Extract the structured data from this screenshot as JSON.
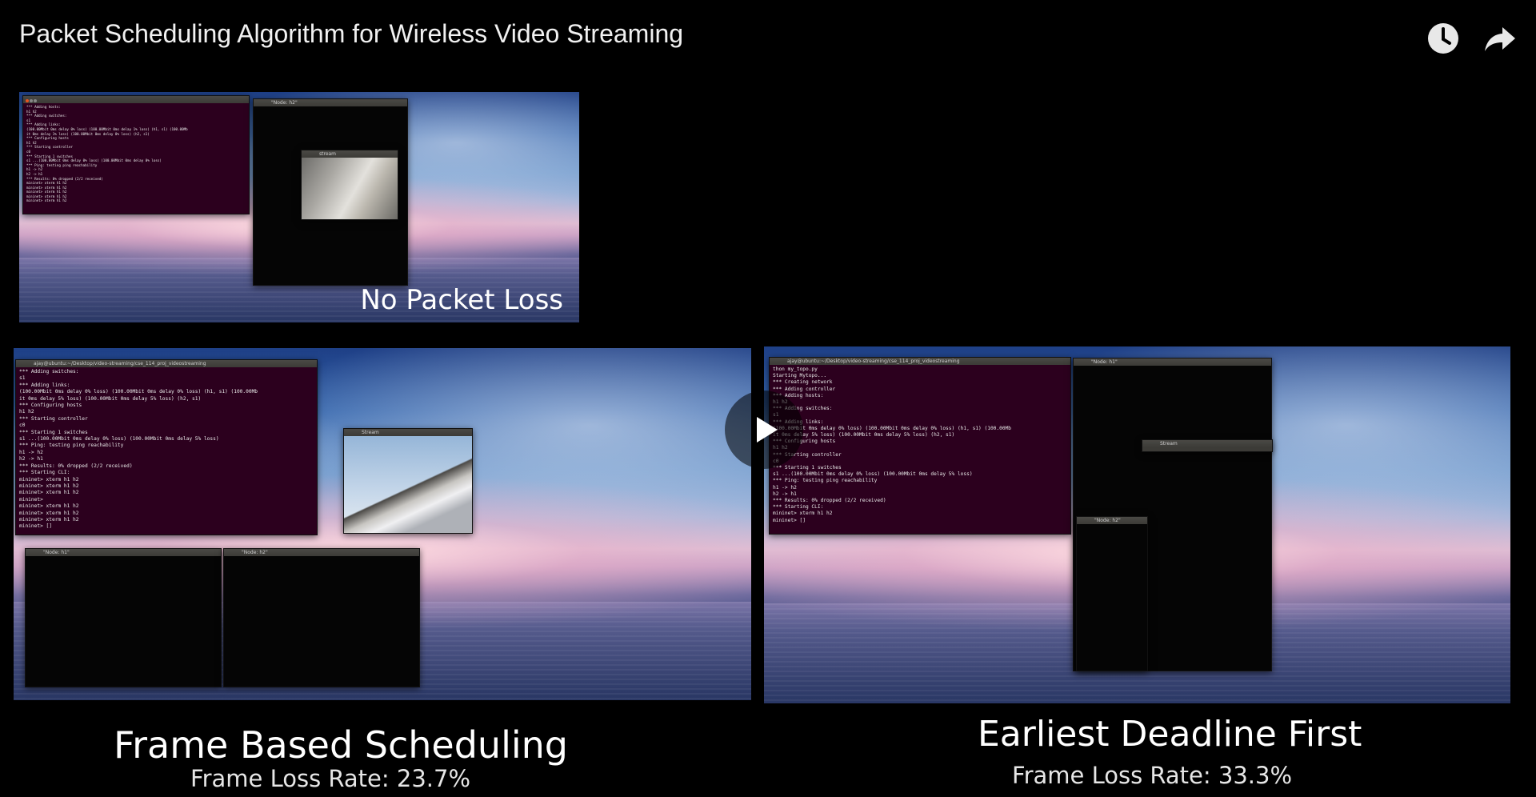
{
  "video": {
    "title": "Packet Scheduling Algorithm for Wireless Video Streaming",
    "actions": [
      "clock-icon",
      "share-icon"
    ]
  },
  "panels": {
    "no_loss": {
      "label": "No Packet Loss",
      "terminal_lines": "*** Adding hosts:\nh1 h2\n*** Adding switches:\ns1\n*** Adding links:\n(100.00Mbit 0ms delay 0% loss) (100.00Mbit 0ms delay 1% loss) (h1, s1) (100.00Mb\nit 0ms delay 1% loss) (100.00Mbit 0ms delay 0% loss) (h2, s1)\n*** Configuring hosts\nh1 h2\n*** Starting controller\nc0\n*** Starting 1 switches\ns1 ...(100.00Mbit 0ms delay 0% loss) (100.00Mbit 0ms delay 0% loss)\n*** Ping: testing ping reachability\nh1 -> h2\nh2 -> h1\n*** Results: 0% dropped (2/2 received)\nmininet> xterm h1 h2\nmininet> xterm h1 h2\nmininet> xterm h1 h2\nmininet> xterm h1 h2\nmininet> xterm h1 h2",
      "node_title": "\"Node: h2\"",
      "stream_title": "stream"
    },
    "frame_based": {
      "title": "Frame Based Scheduling",
      "loss_label": "Frame Loss Rate: 23.7%",
      "terminal_title": "ajay@ubuntu:~/Desktop/video-streaming/cse_114_proj_videostreaming",
      "terminal_lines": "*** Adding switches:\ns1\n*** Adding links:\n(100.00Mbit 0ms delay 0% loss) (100.00Mbit 0ms delay 0% loss) (h1, s1) (100.00Mb\nit 0ms delay 5% loss) (100.00Mbit 0ms delay 5% loss) (h2, s1)\n*** Configuring hosts\nh1 h2\n*** Starting controller\nc0\n*** Starting 1 switches\ns1 ...(100.00Mbit 0ms delay 0% loss) (100.00Mbit 0ms delay 5% loss)\n*** Ping: testing ping reachability\nh1 -> h2\nh2 -> h1\n*** Results: 0% dropped (2/2 received)\n*** Starting CLI:\nmininet> xterm h1 h2\nmininet> xterm h1 h2\nmininet> xterm h1 h2\nmininet>\nmininet> xterm h1 h2\nmininet> xterm h1 h2\nmininet> xterm h1 h2\nmininet> []",
      "stream_title": "Stream",
      "node1_title": "\"Node: h1\"",
      "node2_title": "\"Node: h2\""
    },
    "edf": {
      "title": "Earliest Deadline First",
      "loss_label": "Frame Loss Rate: 33.3%",
      "terminal_title": "ajay@ubuntu:~/Desktop/video-streaming/cse_114_proj_videostreaming",
      "terminal_lines": "thon my_topo.py\nStarting Mytopo...\n*** Creating network\n*** Adding controller\n*** Adding hosts:\nh1 h2\n*** Adding switches:\ns1\n*** Adding links:\n(100.00Mbit 0ms delay 0% loss) (100.00Mbit 0ms delay 0% loss) (h1, s1) (100.00Mb\nit 0ms delay 5% loss) (100.00Mbit 0ms delay 5% loss) (h2, s1)\n*** Configuring hosts\nh1 h2\n*** Starting controller\nc0\n*** Starting 1 switches\ns1 ...(100.00Mbit 0ms delay 0% loss) (100.00Mbit 0ms delay 5% loss)\n*** Ping: testing ping reachability\nh1 -> h2\nh2 -> h1\n*** Results: 0% dropped (2/2 received)\n*** Starting CLI:\nmininet> xterm h1 h2\nmininet> []",
      "node1_title": "\"Node: h1\"",
      "node2_title": "\"Node: h2\"",
      "stream_title": "Stream"
    }
  },
  "player": {
    "play_icon": "play-icon"
  },
  "colors": {
    "terminal_bg": "#2c001e",
    "accent": "#e95420"
  }
}
